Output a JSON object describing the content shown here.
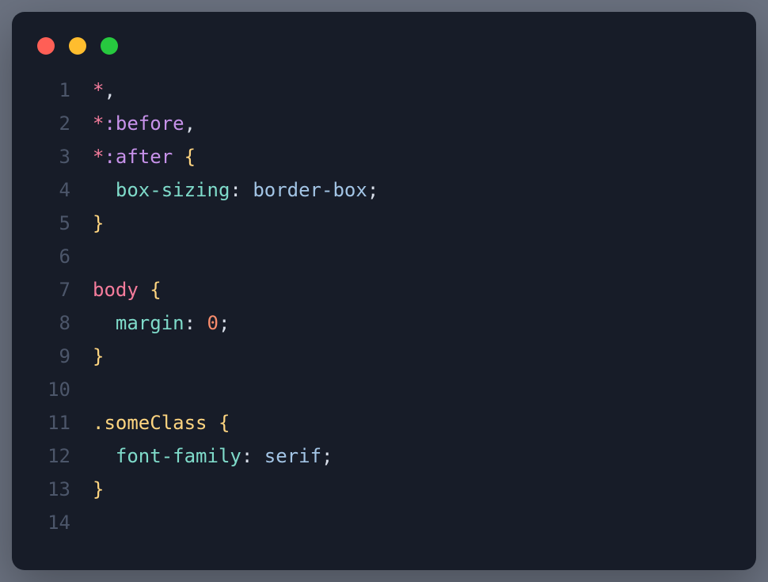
{
  "colors": {
    "background": "#171c28",
    "traffic_red": "#ff5f56",
    "traffic_yellow": "#ffbd2e",
    "traffic_green": "#27c93f",
    "line_number": "#4c566a",
    "selector": "#f57c9c",
    "pseudo": "#c792ea",
    "brace": "#ffd580",
    "property": "#7fdbca",
    "value": "#a3c5e6",
    "number": "#f78c6c",
    "class": "#ffd580",
    "text": "#d8dee9"
  },
  "lines": [
    {
      "num": "1",
      "tokens": [
        {
          "t": "*",
          "c": "tok-selector"
        },
        {
          "t": ",",
          "c": "tok-punct"
        }
      ]
    },
    {
      "num": "2",
      "tokens": [
        {
          "t": "*",
          "c": "tok-selector"
        },
        {
          "t": ":before",
          "c": "tok-pseudo"
        },
        {
          "t": ",",
          "c": "tok-punct"
        }
      ]
    },
    {
      "num": "3",
      "tokens": [
        {
          "t": "*",
          "c": "tok-selector"
        },
        {
          "t": ":after",
          "c": "tok-pseudo"
        },
        {
          "t": " ",
          "c": ""
        },
        {
          "t": "{",
          "c": "tok-brace"
        }
      ]
    },
    {
      "num": "4",
      "tokens": [
        {
          "t": "  ",
          "c": ""
        },
        {
          "t": "box-sizing",
          "c": "tok-prop"
        },
        {
          "t": ": ",
          "c": "tok-punct"
        },
        {
          "t": "border-box",
          "c": "tok-value"
        },
        {
          "t": ";",
          "c": "tok-punct"
        }
      ]
    },
    {
      "num": "5",
      "tokens": [
        {
          "t": "}",
          "c": "tok-brace"
        }
      ]
    },
    {
      "num": "6",
      "tokens": []
    },
    {
      "num": "7",
      "tokens": [
        {
          "t": "body",
          "c": "tok-selector"
        },
        {
          "t": " ",
          "c": ""
        },
        {
          "t": "{",
          "c": "tok-brace"
        }
      ]
    },
    {
      "num": "8",
      "tokens": [
        {
          "t": "  ",
          "c": ""
        },
        {
          "t": "margin",
          "c": "tok-prop"
        },
        {
          "t": ": ",
          "c": "tok-punct"
        },
        {
          "t": "0",
          "c": "tok-number"
        },
        {
          "t": ";",
          "c": "tok-punct"
        }
      ]
    },
    {
      "num": "9",
      "tokens": [
        {
          "t": "}",
          "c": "tok-brace"
        }
      ]
    },
    {
      "num": "10",
      "tokens": []
    },
    {
      "num": "11",
      "tokens": [
        {
          "t": ".someClass",
          "c": "tok-class"
        },
        {
          "t": " ",
          "c": ""
        },
        {
          "t": "{",
          "c": "tok-brace"
        }
      ]
    },
    {
      "num": "12",
      "tokens": [
        {
          "t": "  ",
          "c": ""
        },
        {
          "t": "font-family",
          "c": "tok-prop"
        },
        {
          "t": ": ",
          "c": "tok-punct"
        },
        {
          "t": "serif",
          "c": "tok-value"
        },
        {
          "t": ";",
          "c": "tok-punct"
        }
      ]
    },
    {
      "num": "13",
      "tokens": [
        {
          "t": "}",
          "c": "tok-brace"
        }
      ]
    },
    {
      "num": "14",
      "tokens": []
    }
  ]
}
